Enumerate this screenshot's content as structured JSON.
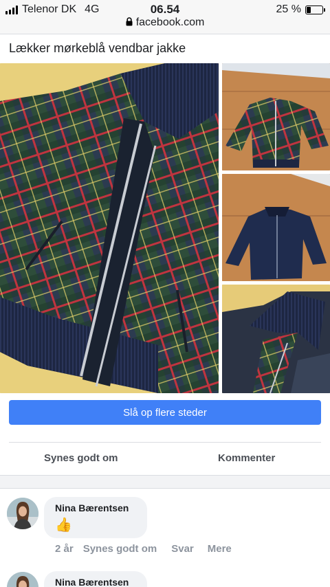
{
  "status_bar": {
    "carrier": "Telenor DK",
    "network": "4G",
    "time": "06.54",
    "url": "facebook.com",
    "battery_percent_label": "25 %",
    "battery_level": 0.25
  },
  "post": {
    "title": "Lækker mørkeblå vendbar jakke",
    "cta_label": "Slå op flere steder",
    "actions": {
      "like_label": "Synes godt om",
      "comment_label": "Kommenter"
    }
  },
  "photos": [
    {
      "icon": "plaid-jacket-photo"
    },
    {
      "icon": "plaid-jacket-floor-photo"
    },
    {
      "icon": "navy-jacket-floor-photo"
    },
    {
      "icon": "jacket-collar-closeup-photo"
    }
  ],
  "comments": [
    {
      "author": "Nina Bærentsen",
      "emoji": "👍",
      "meta": {
        "age": "2 år",
        "like_label": "Synes godt om",
        "reply_label": "Svar",
        "more_label": "Mere"
      }
    },
    {
      "author": "Nina Bærentsen"
    }
  ],
  "colors": {
    "accent": "#4080f7",
    "meta_text": "#8d949e",
    "bubble": "#f0f2f5"
  }
}
